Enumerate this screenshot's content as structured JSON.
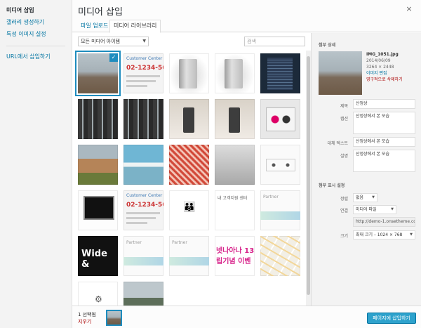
{
  "menu": {
    "items": [
      {
        "label": "미디어 삽입"
      },
      {
        "label": "갤러리 생성하기"
      },
      {
        "label": "특성 이미지 설정"
      },
      {
        "label": "URL에서 삽입하기"
      }
    ]
  },
  "frame": {
    "title": "미디어 삽입",
    "close_icon": "×"
  },
  "tabs": [
    {
      "label": "파일 업로드"
    },
    {
      "label": "미디어 라이브러리"
    }
  ],
  "toolbar": {
    "filter_value": "모든 미디어 아이템",
    "search_placeholder": "검색"
  },
  "grid": {
    "items": [
      {
        "kind": "landscape",
        "selected": true
      },
      {
        "kind": "doc-cc",
        "line1": "Customer Center",
        "line2": "02-1234-5678"
      },
      {
        "kind": "server-silver"
      },
      {
        "kind": "server-silver"
      },
      {
        "kind": "server-dark"
      },
      {
        "kind": "racks"
      },
      {
        "kind": "racks"
      },
      {
        "kind": "desk"
      },
      {
        "kind": "desk"
      },
      {
        "kind": "speaker"
      },
      {
        "kind": "horse"
      },
      {
        "kind": "sea"
      },
      {
        "kind": "pattern"
      },
      {
        "kind": "office"
      },
      {
        "kind": "audio"
      },
      {
        "kind": "imac"
      },
      {
        "kind": "doc-cc",
        "line1": "Customer Center",
        "line2": "02-1234-5678"
      },
      {
        "kind": "family"
      },
      {
        "kind": "textdoc",
        "text": "내 고객지원 센터"
      },
      {
        "kind": "partner",
        "text": "Partner"
      },
      {
        "kind": "wide",
        "text": "Wide &"
      },
      {
        "kind": "partner",
        "text": "Partner"
      },
      {
        "kind": "partner",
        "text": "Partner"
      },
      {
        "kind": "banner",
        "text": "넷나아나 13 립기념 이벤"
      },
      {
        "kind": "mapx"
      },
      {
        "kind": "bug",
        "text": "⚙"
      },
      {
        "kind": "hills"
      }
    ]
  },
  "details": {
    "heading": "첨부 상세",
    "filename": "IMG_1051.jpg",
    "date": "2014/06/09",
    "dimensions": "3264 × 2448",
    "edit_label": "이미지 편집",
    "delete_label": "영구적으로 삭제하기",
    "fields": {
      "title_label": "제목",
      "title_value": "산정상",
      "caption_label": "캡션",
      "caption_value": "산정상에서 본 모습",
      "alt_label": "대체 텍스트",
      "alt_value": "산정상에서 본 모습",
      "desc_label": "설명",
      "desc_value": "산정상에서 본 모습"
    }
  },
  "display": {
    "heading": "첨부 표시 설정",
    "align_label": "정렬",
    "align_value": "없음",
    "link_label": "연결",
    "link_value": "미디어 파일",
    "url_value": "http://demo-1.onsetheme.co",
    "size_label": "크기",
    "size_value": "최대 크기 – 1024 × 768"
  },
  "bottom": {
    "count": "1 선택됨",
    "clear": "지우기",
    "insert": "페이지에 삽입하기"
  }
}
